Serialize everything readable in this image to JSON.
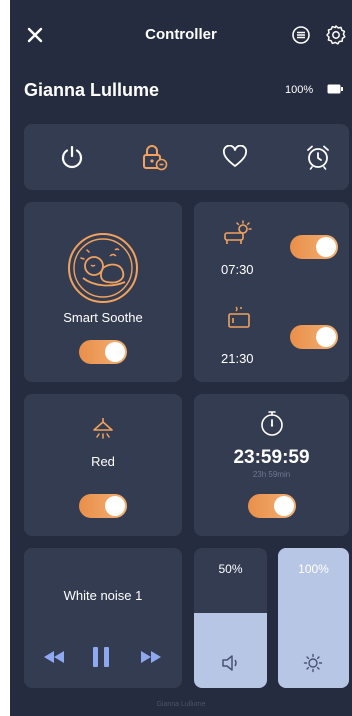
{
  "header": {
    "title": "Controller",
    "close_icon": "close-icon",
    "menu_icon": "list-icon",
    "settings_icon": "gear-icon"
  },
  "device": {
    "name": "Gianna Lullume",
    "battery_percent": "100%"
  },
  "quick_actions": [
    "power-icon",
    "child-lock-icon",
    "heart-icon",
    "alarm-clock-icon"
  ],
  "smart_soothe": {
    "label": "Smart Soothe",
    "enabled": true
  },
  "schedules": [
    {
      "icon": "wake-sun-icon",
      "time": "07:30",
      "enabled": true
    },
    {
      "icon": "sleep-moon-icon",
      "time": "21:30",
      "enabled": true
    }
  ],
  "light": {
    "label": "Red",
    "enabled": true
  },
  "timer": {
    "time": "23:59:59",
    "sub": "23h 59min",
    "enabled": true
  },
  "sound": {
    "track": "White noise 1",
    "volume_label": "50%",
    "volume_level": 0.5,
    "brightness_label": "100%",
    "brightness_level": 1.0
  },
  "footer": {
    "text": "Gianna Lullume"
  },
  "colors": {
    "background": "#262c3f",
    "card": "#343c52",
    "accent": "#f0a25e",
    "slider_fill": "#b8c6e6"
  }
}
